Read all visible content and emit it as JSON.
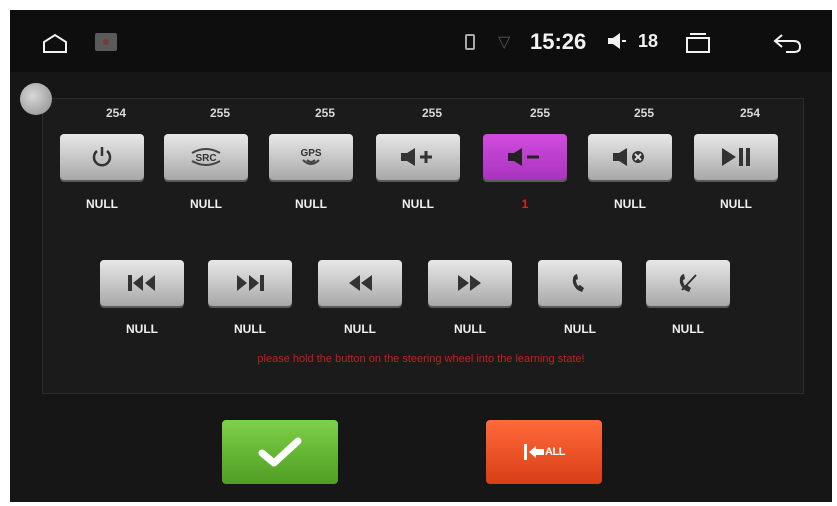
{
  "status_bar": {
    "time": "15:26",
    "volume_level": "18",
    "icons": [
      "home-icon",
      "app-thumbnail",
      "phone-icon",
      "wifi-icon",
      "volume-icon",
      "recents-icon",
      "back-icon"
    ]
  },
  "row1": [
    {
      "code": "254",
      "label": "NULL",
      "icon": "power-icon"
    },
    {
      "code": "255",
      "label": "NULL",
      "icon": "src-icon",
      "text": "SRC"
    },
    {
      "code": "255",
      "label": "NULL",
      "icon": "gps-icon",
      "text": "GPS"
    },
    {
      "code": "255",
      "label": "NULL",
      "icon": "volume-up-icon"
    },
    {
      "code": "255",
      "label": "1",
      "icon": "volume-down-icon",
      "active": true
    },
    {
      "code": "255",
      "label": "NULL",
      "icon": "mute-icon"
    },
    {
      "code": "254",
      "label": "NULL",
      "icon": "play-pause-icon"
    }
  ],
  "row2": [
    {
      "label": "NULL",
      "icon": "previous-track-icon"
    },
    {
      "label": "NULL",
      "icon": "next-track-icon"
    },
    {
      "label": "NULL",
      "icon": "rewind-icon"
    },
    {
      "label": "NULL",
      "icon": "fast-forward-icon"
    },
    {
      "label": "NULL",
      "icon": "call-answer-icon"
    },
    {
      "label": "NULL",
      "icon": "call-hangup-icon"
    }
  ],
  "hint": "please hold the button on the steering wheel into the learning state!",
  "actions": {
    "confirm_icon": "checkmark-icon",
    "clear_all_label": "ALL"
  },
  "colors": {
    "active_button": "#c03fd6",
    "confirm_button": "#5fb22f",
    "clear_button": "#f04e20",
    "hint_text": "#c61f1f"
  }
}
